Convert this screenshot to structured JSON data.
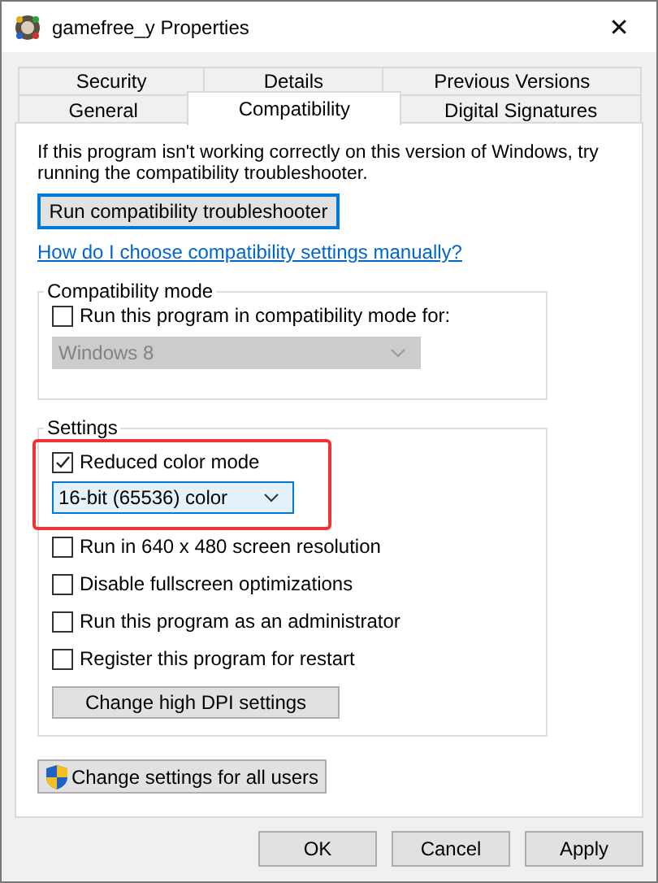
{
  "window": {
    "title": "gamefree_y Properties",
    "close": "✕"
  },
  "tab_rows": [
    [
      {
        "label": "Security",
        "selected": false
      },
      {
        "label": "Details",
        "selected": false
      },
      {
        "label": "Previous Versions",
        "selected": false
      }
    ],
    [
      {
        "label": "General",
        "selected": false
      },
      {
        "label": "Compatibility",
        "selected": true
      },
      {
        "label": "Digital Signatures",
        "selected": false
      }
    ]
  ],
  "intro": "If this program isn't working correctly on this version of Windows, try running the compatibility troubleshooter.",
  "troubleshooter_button": "Run compatibility troubleshooter",
  "help_link": "How do I choose compatibility settings manually?",
  "compatibility_mode": {
    "legend": "Compatibility mode",
    "checkbox": {
      "label": "Run this program in compatibility mode for:",
      "checked": false
    },
    "dropdown": {
      "value": "Windows 8",
      "disabled": true
    }
  },
  "settings": {
    "legend": "Settings",
    "highlighted": true,
    "reduced_color": {
      "label": "Reduced color mode",
      "checked": true
    },
    "color_dropdown": {
      "value": "16-bit (65536) color",
      "disabled": false
    },
    "options": [
      {
        "label": "Run in 640 x 480 screen resolution",
        "checked": false
      },
      {
        "label": "Disable fullscreen optimizations",
        "checked": false
      },
      {
        "label": "Run this program as an administrator",
        "checked": false
      },
      {
        "label": "Register this program for restart",
        "checked": false
      }
    ],
    "dpi_button": "Change high DPI settings"
  },
  "all_users_button": "Change settings for all users",
  "buttons": [
    "OK",
    "Cancel",
    "Apply"
  ]
}
